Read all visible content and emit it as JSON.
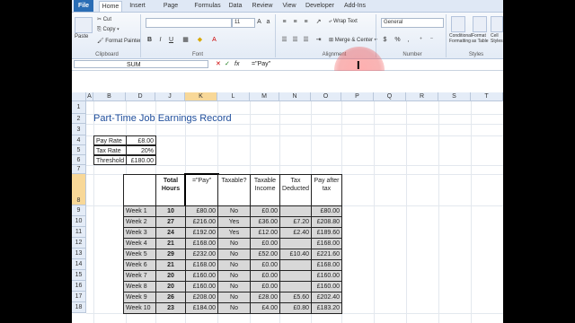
{
  "ribbon_tabs": [
    "File",
    "Home",
    "Insert",
    "Page Layout",
    "Formulas",
    "Data",
    "Review",
    "View",
    "Developer",
    "Add-Ins"
  ],
  "clipboard": {
    "paste": "Paste",
    "cut": "Cut",
    "copy": "Copy",
    "format_painter": "Format Painter",
    "group": "Clipboard"
  },
  "font": {
    "size": "11",
    "group": "Font",
    "bold": "B",
    "italic": "I",
    "underline": "U"
  },
  "alignment": {
    "wrap": "Wrap Text",
    "merge": "Merge & Center",
    "group": "Alignment"
  },
  "number": {
    "format": "General",
    "group": "Number",
    "pct": "%",
    "comma": ","
  },
  "styles": {
    "cond": "Conditional Formatting",
    "table": "Format as Table",
    "cell": "Cell Styles",
    "group": "Styles"
  },
  "formula_bar": {
    "name_box": "SUM",
    "fx": "fx",
    "formula": "=\"Pay\""
  },
  "columns": [
    "A",
    "B",
    "D",
    "J",
    "K",
    "L",
    "M",
    "N",
    "O",
    "P",
    "Q",
    "R",
    "S",
    "T"
  ],
  "rows": [
    "1",
    "2",
    "3",
    "4",
    "5",
    "6",
    "7",
    "8",
    "9",
    "10",
    "11",
    "12",
    "13",
    "14",
    "15",
    "16",
    "17",
    "18"
  ],
  "sheet": {
    "title": "Part-Time Job Earnings Record",
    "params": [
      {
        "label": "Pay Rate",
        "value": "£8.00"
      },
      {
        "label": "Tax Rate",
        "value": "20%"
      },
      {
        "label": "Threshold",
        "value": "£180.00"
      }
    ],
    "headers": {
      "total_hours": "Total Hours",
      "pay": "=\"Pay\"",
      "taxable_q": "Taxable?",
      "taxable_income": "Taxable Income",
      "tax_deducted": "Tax Deducted",
      "pay_after_tax": "Pay after tax"
    },
    "weeks": [
      {
        "week": "Week 1",
        "hours": "10",
        "pay": "£80.00",
        "taxable": "No",
        "income": "£0.00",
        "tax": "",
        "after": "£80.00"
      },
      {
        "week": "Week 2",
        "hours": "27",
        "pay": "£216.00",
        "taxable": "Yes",
        "income": "£36.00",
        "tax": "£7.20",
        "after": "£208.80"
      },
      {
        "week": "Week 3",
        "hours": "24",
        "pay": "£192.00",
        "taxable": "Yes",
        "income": "£12.00",
        "tax": "£2.40",
        "after": "£189.60"
      },
      {
        "week": "Week 4",
        "hours": "21",
        "pay": "£168.00",
        "taxable": "No",
        "income": "£0.00",
        "tax": "",
        "after": "£168.00"
      },
      {
        "week": "Week 5",
        "hours": "29",
        "pay": "£232.00",
        "taxable": "No",
        "income": "£52.00",
        "tax": "£10.40",
        "after": "£221.60"
      },
      {
        "week": "Week 6",
        "hours": "21",
        "pay": "£168.00",
        "taxable": "No",
        "income": "£0.00",
        "tax": "",
        "after": "£168.00"
      },
      {
        "week": "Week 7",
        "hours": "20",
        "pay": "£160.00",
        "taxable": "No",
        "income": "£0.00",
        "tax": "",
        "after": "£160.00"
      },
      {
        "week": "Week 8",
        "hours": "20",
        "pay": "£160.00",
        "taxable": "No",
        "income": "£0.00",
        "tax": "",
        "after": "£160.00"
      },
      {
        "week": "Week 9",
        "hours": "26",
        "pay": "£208.00",
        "taxable": "No",
        "income": "£28.00",
        "tax": "£5.60",
        "after": "£202.40"
      },
      {
        "week": "Week 10",
        "hours": "23",
        "pay": "£184.00",
        "taxable": "No",
        "income": "£4.00",
        "tax": "£0.80",
        "after": "£183.20"
      }
    ]
  }
}
